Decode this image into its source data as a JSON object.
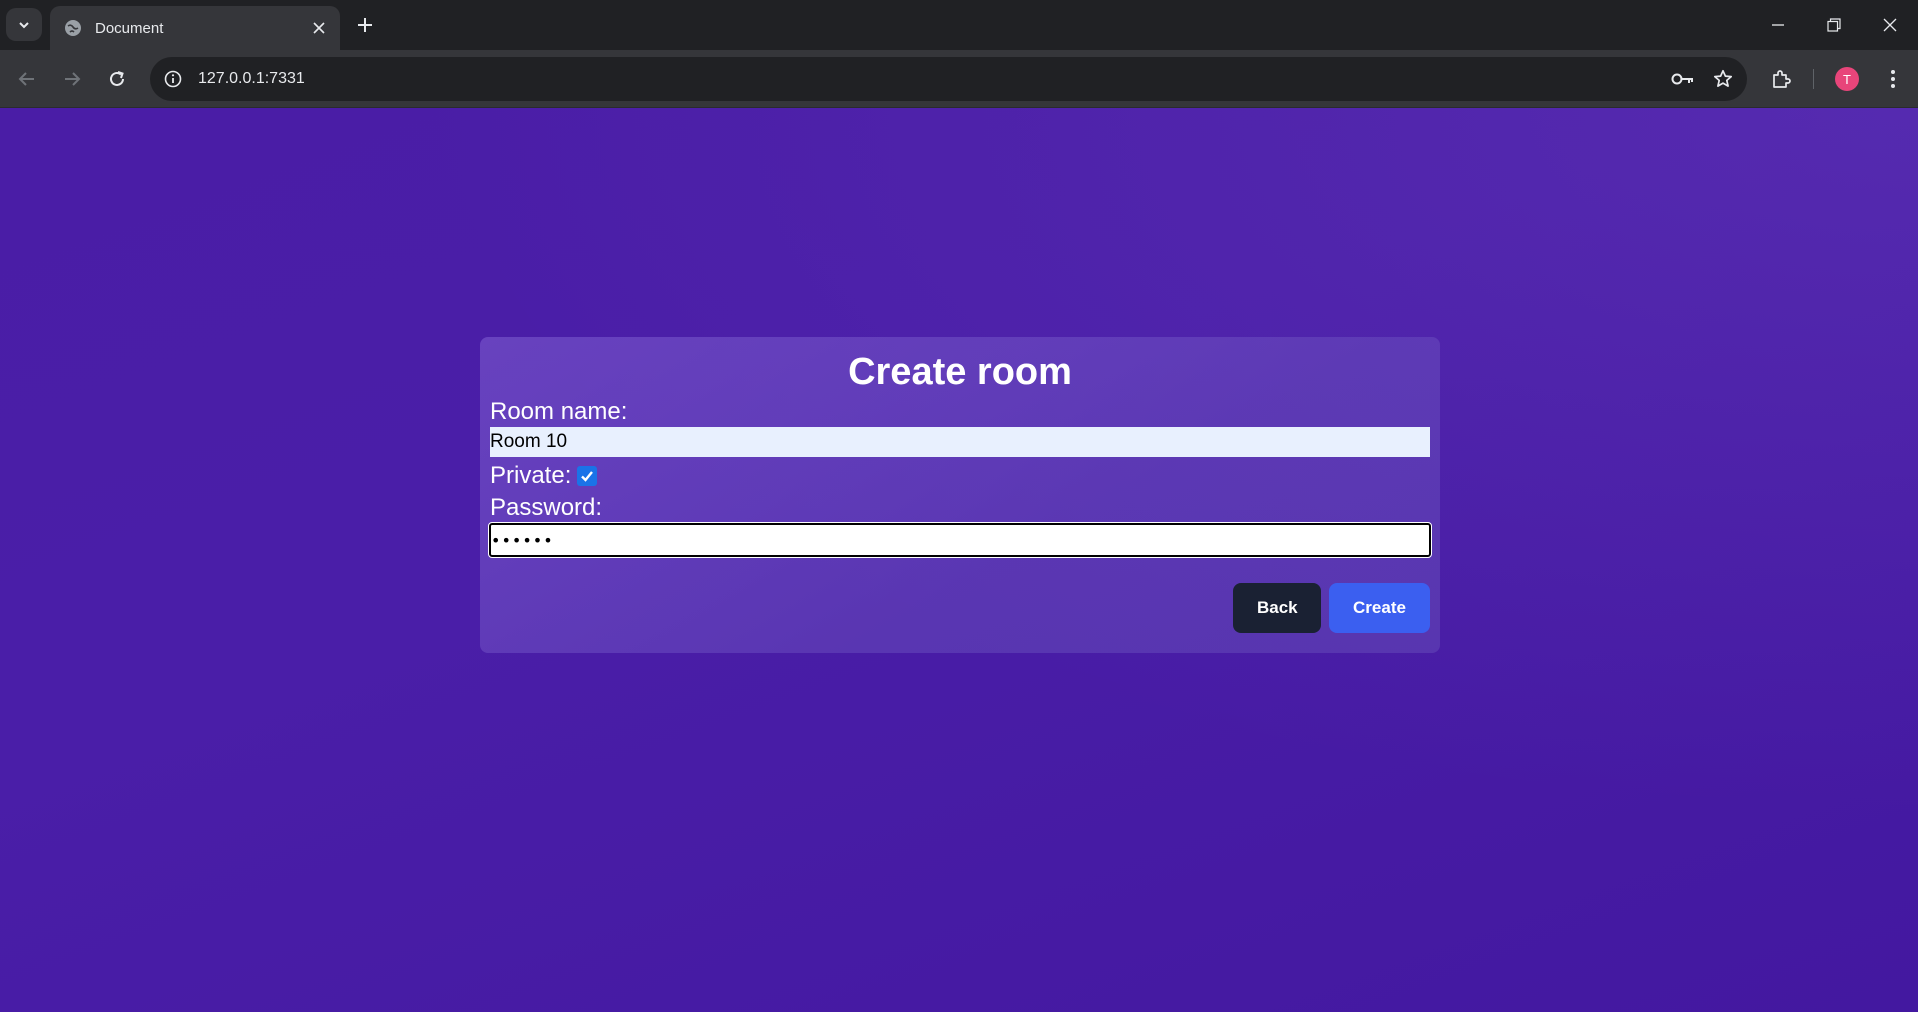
{
  "browser": {
    "tab_title": "Document",
    "url": "127.0.0.1:7331",
    "profile_initial": "T"
  },
  "form": {
    "title": "Create room",
    "room_name_label": "Room name:",
    "room_name_value": "Room 10",
    "private_label": "Private:",
    "private_checked": true,
    "password_label": "Password:",
    "password_value": "••••••",
    "back_label": "Back",
    "create_label": "Create"
  },
  "colors": {
    "background": "#4a1da6",
    "create_button": "#3b5ff0",
    "back_button": "#1a2133",
    "checkbox": "#1a73e8",
    "avatar": "#e8457a"
  }
}
